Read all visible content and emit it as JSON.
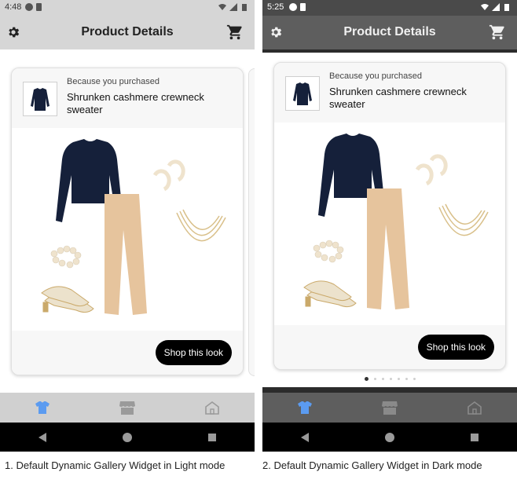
{
  "phones": [
    {
      "theme": "light",
      "status_time": "4:48",
      "title": "Product Details",
      "card": {
        "because": "Because you purchased",
        "product_name": "Shrunken cashmere crewneck sweater",
        "button": "Shop this look"
      },
      "caption": "1. Default Dynamic Gallery Widget in Light mode"
    },
    {
      "theme": "dark",
      "status_time": "5:25",
      "title": "Product Details",
      "card": {
        "because": "Because you purchased",
        "product_name": "Shrunken cashmere crewneck sweater",
        "button": "Shop this look"
      },
      "pagination": {
        "count": 7,
        "active": 0
      },
      "caption": "2. Default Dynamic Gallery Widget in Dark mode"
    }
  ],
  "icons": {
    "settings": "gear-icon",
    "cart": "shopping-cart-icon",
    "nav": [
      "shirt-icon",
      "store-icon",
      "home-icon"
    ],
    "system": [
      "back-icon",
      "home-circle-icon",
      "recents-icon"
    ]
  },
  "colors": {
    "nav_active": "#5b9bf0",
    "nav_inactive_light": "#9a9a9a",
    "nav_inactive_dark": "#8a8a8a",
    "sweater": "#15203a",
    "pants": "#e6c49d",
    "button_bg": "#000000",
    "button_text": "#ffffff"
  }
}
